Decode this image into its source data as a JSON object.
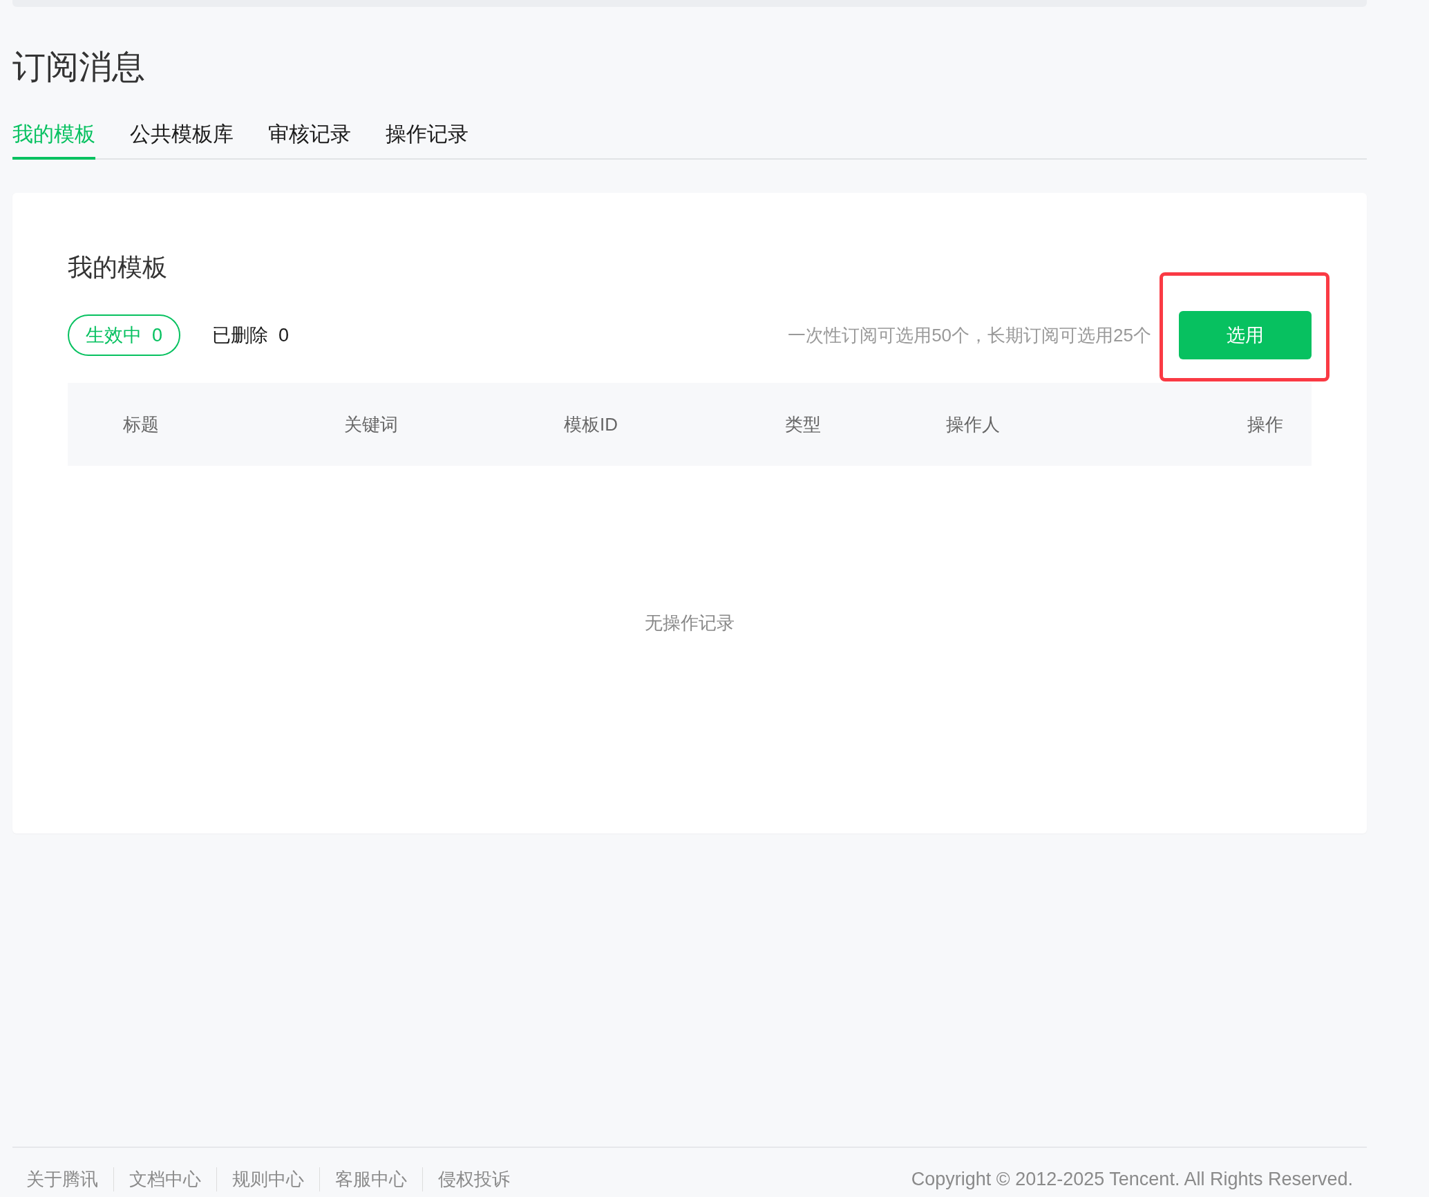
{
  "page_title": "订阅消息",
  "tabs": [
    {
      "label": "我的模板",
      "selected": true
    },
    {
      "label": "公共模板库",
      "selected": false
    },
    {
      "label": "审核记录",
      "selected": false
    },
    {
      "label": "操作记录",
      "selected": false
    }
  ],
  "card": {
    "title": "我的模板",
    "filters": [
      {
        "label": "生效中",
        "count": "0",
        "selected": true
      },
      {
        "label": "已删除",
        "count": "0",
        "selected": false
      }
    ],
    "note": "一次性订阅可选用50个，长期订阅可选用25个",
    "button": "选用",
    "highlighted": true,
    "table": {
      "columns": [
        "标题",
        "关键词",
        "模板ID",
        "类型",
        "操作人",
        "操作"
      ],
      "empty_text": "无操作记录"
    }
  },
  "footer": {
    "links": [
      "关于腾讯",
      "文档中心",
      "规则中心",
      "客服中心",
      "侵权投诉"
    ],
    "copyright": "Copyright © 2012-2025 Tencent. All Rights Reserved."
  }
}
